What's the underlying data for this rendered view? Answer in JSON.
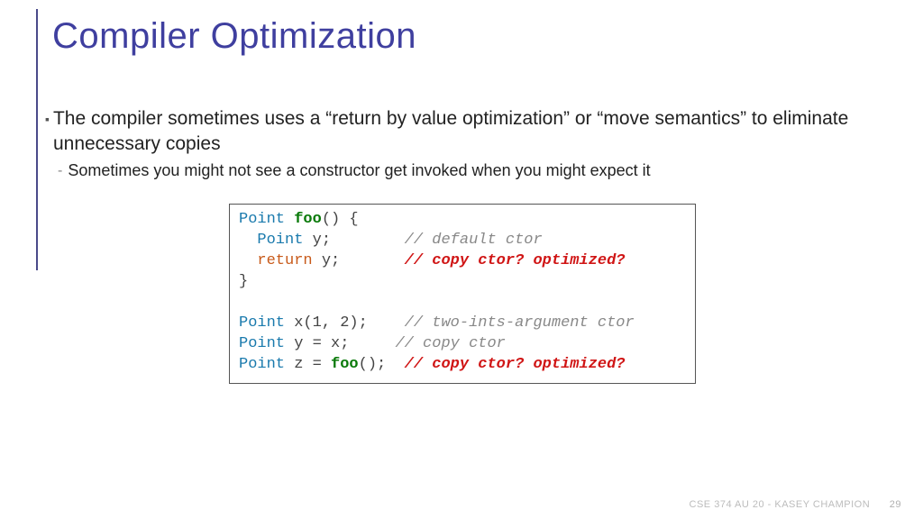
{
  "title": "Compiler Optimization",
  "bullet": {
    "text": "The compiler sometimes uses a “return by value optimization” or “move semantics” to eliminate unnecessary copies",
    "sub": "Sometimes you might not see a constructor get invoked when you might expect it"
  },
  "code": {
    "l1": {
      "type": "Point",
      "func": "foo",
      "rest": "() {"
    },
    "l2": {
      "indent": "  ",
      "type": "Point",
      "rest": " y;",
      "pad": "        ",
      "comment": "// default ctor"
    },
    "l3": {
      "indent": "  ",
      "kw": "return",
      "rest": " y;",
      "pad": "       ",
      "hot": "// copy ctor? optimized?"
    },
    "l4": {
      "rest": "}"
    },
    "l5": {
      "rest": ""
    },
    "l6": {
      "type": "Point",
      "rest": " x(1, 2);",
      "pad": "    ",
      "comment": "// two-ints-argument ctor"
    },
    "l7": {
      "type": "Point",
      "rest": " y = x;",
      "pad": "     ",
      "comment": "// copy ctor"
    },
    "l8": {
      "type": "Point",
      "rest": " z = ",
      "func": "foo",
      "rest2": "();",
      "pad": "  ",
      "hot": "// copy ctor? optimized?"
    }
  },
  "footer": {
    "text": "CSE 374 AU 20 - KASEY CHAMPION",
    "page": "29"
  }
}
